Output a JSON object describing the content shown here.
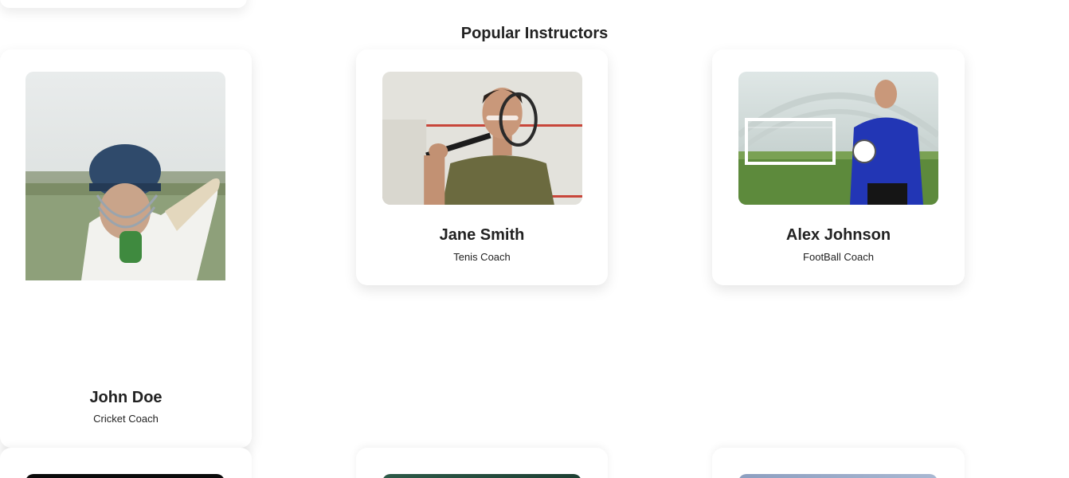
{
  "section": {
    "title": "Popular Instructors"
  },
  "instructors": [
    {
      "name": "John Doe",
      "role": "Cricket Coach"
    },
    {
      "name": "Jane Smith",
      "role": "Tenis Coach"
    },
    {
      "name": "Alex Johnson",
      "role": "FootBall Coach"
    }
  ]
}
